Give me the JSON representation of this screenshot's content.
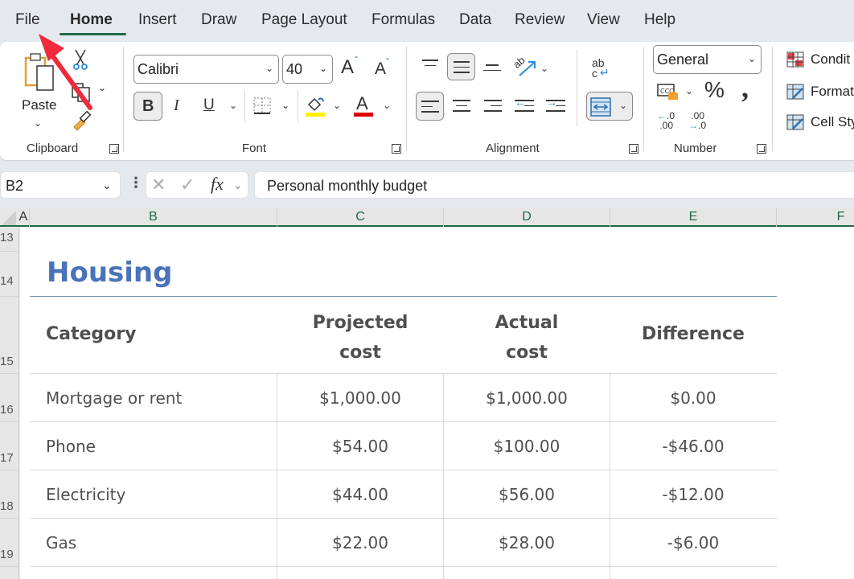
{
  "menu": {
    "tabs": [
      {
        "label": "File",
        "active": false
      },
      {
        "label": "Home",
        "active": true
      },
      {
        "label": "Insert",
        "active": false
      },
      {
        "label": "Draw",
        "active": false
      },
      {
        "label": "Page Layout",
        "active": false
      },
      {
        "label": "Formulas",
        "active": false
      },
      {
        "label": "Data",
        "active": false
      },
      {
        "label": "Review",
        "active": false
      },
      {
        "label": "View",
        "active": false
      },
      {
        "label": "Help",
        "active": false
      }
    ]
  },
  "ribbon": {
    "clipboard": {
      "label": "Clipboard",
      "paste_label": "Paste",
      "icons": [
        "paste-icon",
        "cut-icon",
        "copy-icon",
        "format-painter-icon"
      ]
    },
    "font": {
      "label": "Font",
      "font_name": "Calibri",
      "font_size": "40",
      "bold": "B",
      "italic": "I",
      "underline": "U",
      "grow": "A",
      "shrink": "A",
      "font_color_letter": "A",
      "fill_color": "#ffee00",
      "font_color": "#dd0000"
    },
    "alignment": {
      "label": "Alignment",
      "wrap_text_label": "ab c"
    },
    "number": {
      "label": "Number",
      "format": "General",
      "percent": "%",
      "comma": ",",
      "increase_decimal": "←.0 .00",
      "decrease_decimal": ".00 →.0"
    },
    "styles": {
      "items": [
        "Condit",
        "Format",
        "Cell Sty"
      ]
    }
  },
  "formula_bar": {
    "name_box": "B2",
    "fx": "fx",
    "value": "Personal monthly budget"
  },
  "columns": [
    "A",
    "B",
    "C",
    "D",
    "E",
    "F"
  ],
  "rows": [
    "13",
    "14",
    "15",
    "16",
    "17",
    "18",
    "19"
  ],
  "sheet": {
    "section_title": "Housing",
    "headers": {
      "category": "Category",
      "projected_line1": "Projected",
      "projected_line2": "cost",
      "actual_line1": "Actual",
      "actual_line2": "cost",
      "difference": "Difference"
    },
    "table": [
      {
        "category": "Mortgage or rent",
        "projected": "$1,000.00",
        "actual": "$1,000.00",
        "difference": "$0.00"
      },
      {
        "category": "Phone",
        "projected": "$54.00",
        "actual": "$100.00",
        "difference": "-$46.00"
      },
      {
        "category": "Electricity",
        "projected": "$44.00",
        "actual": "$56.00",
        "difference": "-$12.00"
      },
      {
        "category": "Gas",
        "projected": "$22.00",
        "actual": "$28.00",
        "difference": "-$6.00"
      }
    ]
  },
  "colors": {
    "accent_green": "#1e6b45",
    "title_blue": "#4a72b8",
    "annotation_arrow": "#ee2a3c"
  }
}
